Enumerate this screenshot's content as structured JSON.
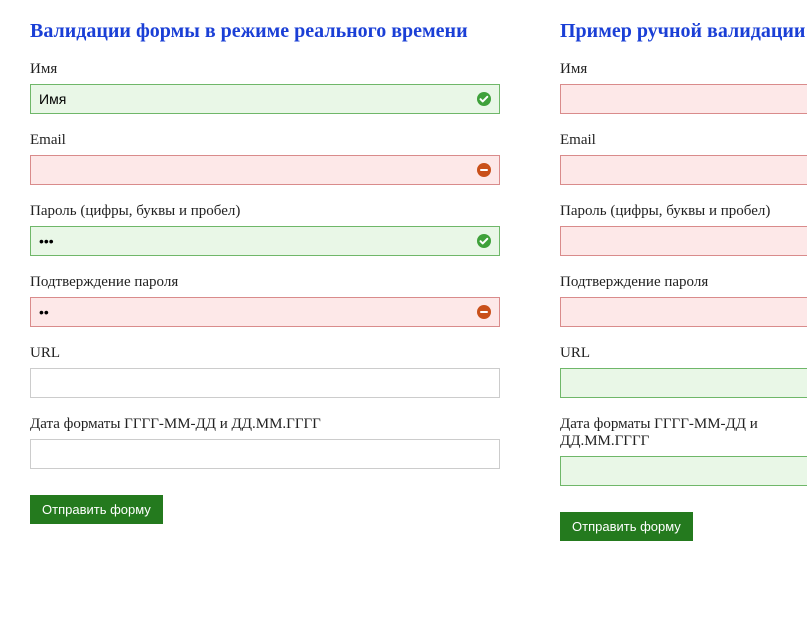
{
  "forms": {
    "realtime": {
      "heading": "Валидации формы в режиме реального времени",
      "fields": {
        "name": {
          "label": "Имя",
          "value": "Имя",
          "state": "valid"
        },
        "email": {
          "label": "Email",
          "value": "",
          "state": "invalid"
        },
        "password": {
          "label": "Пароль (цифры, буквы и пробел)",
          "value": "•••",
          "state": "valid"
        },
        "confirm": {
          "label": "Подтверждение пароля",
          "value": "••",
          "state": "invalid"
        },
        "url": {
          "label": "URL",
          "value": "",
          "state": "neutral"
        },
        "date": {
          "label": "Дата форматы ГГГГ-ММ-ДД и ДД.ММ.ГГГГ",
          "value": "",
          "state": "neutral"
        }
      },
      "submit": "Отправить форму"
    },
    "manual": {
      "heading": "Пример ручной валидации",
      "fields": {
        "name": {
          "label": "Имя",
          "value": "",
          "state": "invalid-noicon"
        },
        "email": {
          "label": "Email",
          "value": "",
          "state": "invalid-noicon"
        },
        "password": {
          "label": "Пароль (цифры, буквы и пробел)",
          "value": "",
          "state": "invalid-noicon"
        },
        "confirm": {
          "label": "Подтверждение пароля",
          "value": "",
          "state": "invalid-noicon"
        },
        "url": {
          "label": "URL",
          "value": "",
          "state": "neutral-green"
        },
        "date": {
          "label": "Дата форматы ГГГГ-ММ-ДД и ДД.ММ.ГГГГ",
          "value": "",
          "state": "neutral-green"
        }
      },
      "submit": "Отправить форму"
    }
  },
  "colors": {
    "heading": "#1a3fd6",
    "validBg": "#e9f7e7",
    "validBorder": "#6fb769",
    "invalidBg": "#fde8e8",
    "invalidBorder": "#d98b8b",
    "button": "#247a1e",
    "iconValid": "#3fa13b",
    "iconInvalid": "#c9501a"
  }
}
